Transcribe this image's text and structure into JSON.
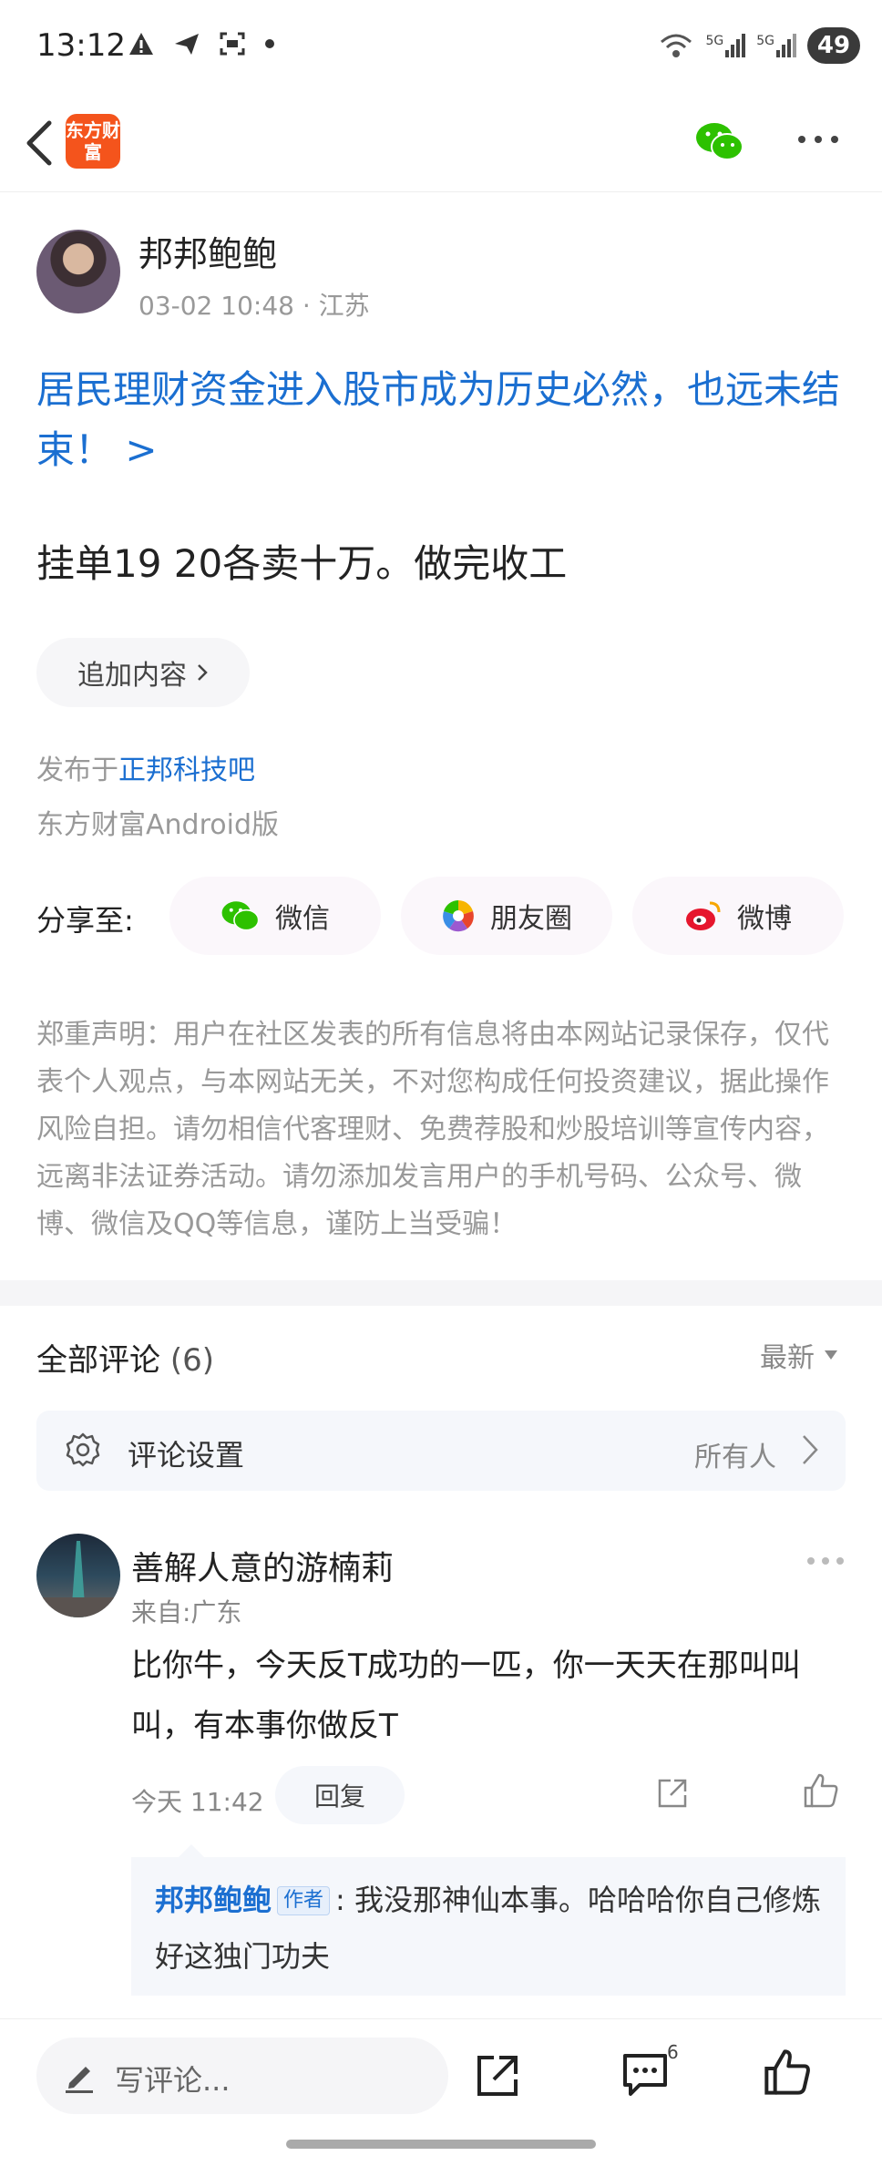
{
  "status_bar": {
    "time": "13:12",
    "battery": "49",
    "signal_label_1": "5G",
    "signal_label_2": "5G"
  },
  "nav": {
    "logo_text": "东方财富"
  },
  "post": {
    "author": "邦邦鲍鲍",
    "datetime": "03-02 10:48",
    "location": "· 江苏",
    "title": "居民理财资金进入股市成为历史必然，也远未结束！ >",
    "body": "挂单19 20各卖十万。做完收工",
    "add_content": "追加内容",
    "published_prefix": "发布于",
    "published_link": "正邦科技吧",
    "client": "东方财富Android版"
  },
  "share": {
    "label": "分享至:",
    "targets": [
      {
        "label": "微信",
        "icon": "wechat-icon"
      },
      {
        "label": "朋友圈",
        "icon": "moments-icon"
      },
      {
        "label": "微博",
        "icon": "weibo-icon"
      }
    ]
  },
  "notice": "郑重声明：用户在社区发表的所有信息将由本网站记录保存，仅代表个人观点，与本网站无关，不对您构成任何投资建议，据此操作风险自担。请勿相信代客理财、免费荐股和炒股培训等宣传内容，远离非法证券活动。请勿添加发言用户的手机号码、公众号、微博、微信及QQ等信息，谨防上当受骗！",
  "comments": {
    "title": "全部评论",
    "count": "(6)",
    "sort": "最新",
    "settings_label": "评论设置",
    "settings_value": "所有人",
    "items": [
      {
        "name": "善解人意的游楠莉",
        "from": "来自:广东",
        "text": "比你牛，今天反T成功的一匹，你一天天在那叫叫叫，有本事你做反T",
        "time": "今天 11:42",
        "reply_label": "回复",
        "reply": {
          "name": "邦邦鲍鲍",
          "tag": "作者",
          "text": ": 我没那神仙本事。哈哈哈你自己修炼好这独门功夫"
        }
      }
    ]
  },
  "bottom_bar": {
    "placeholder": "写评论...",
    "comment_badge": "6"
  },
  "colors": {
    "link_blue": "#1b6fd1",
    "brand_orange": "#f4541c",
    "wechat_green": "#2dc100"
  }
}
